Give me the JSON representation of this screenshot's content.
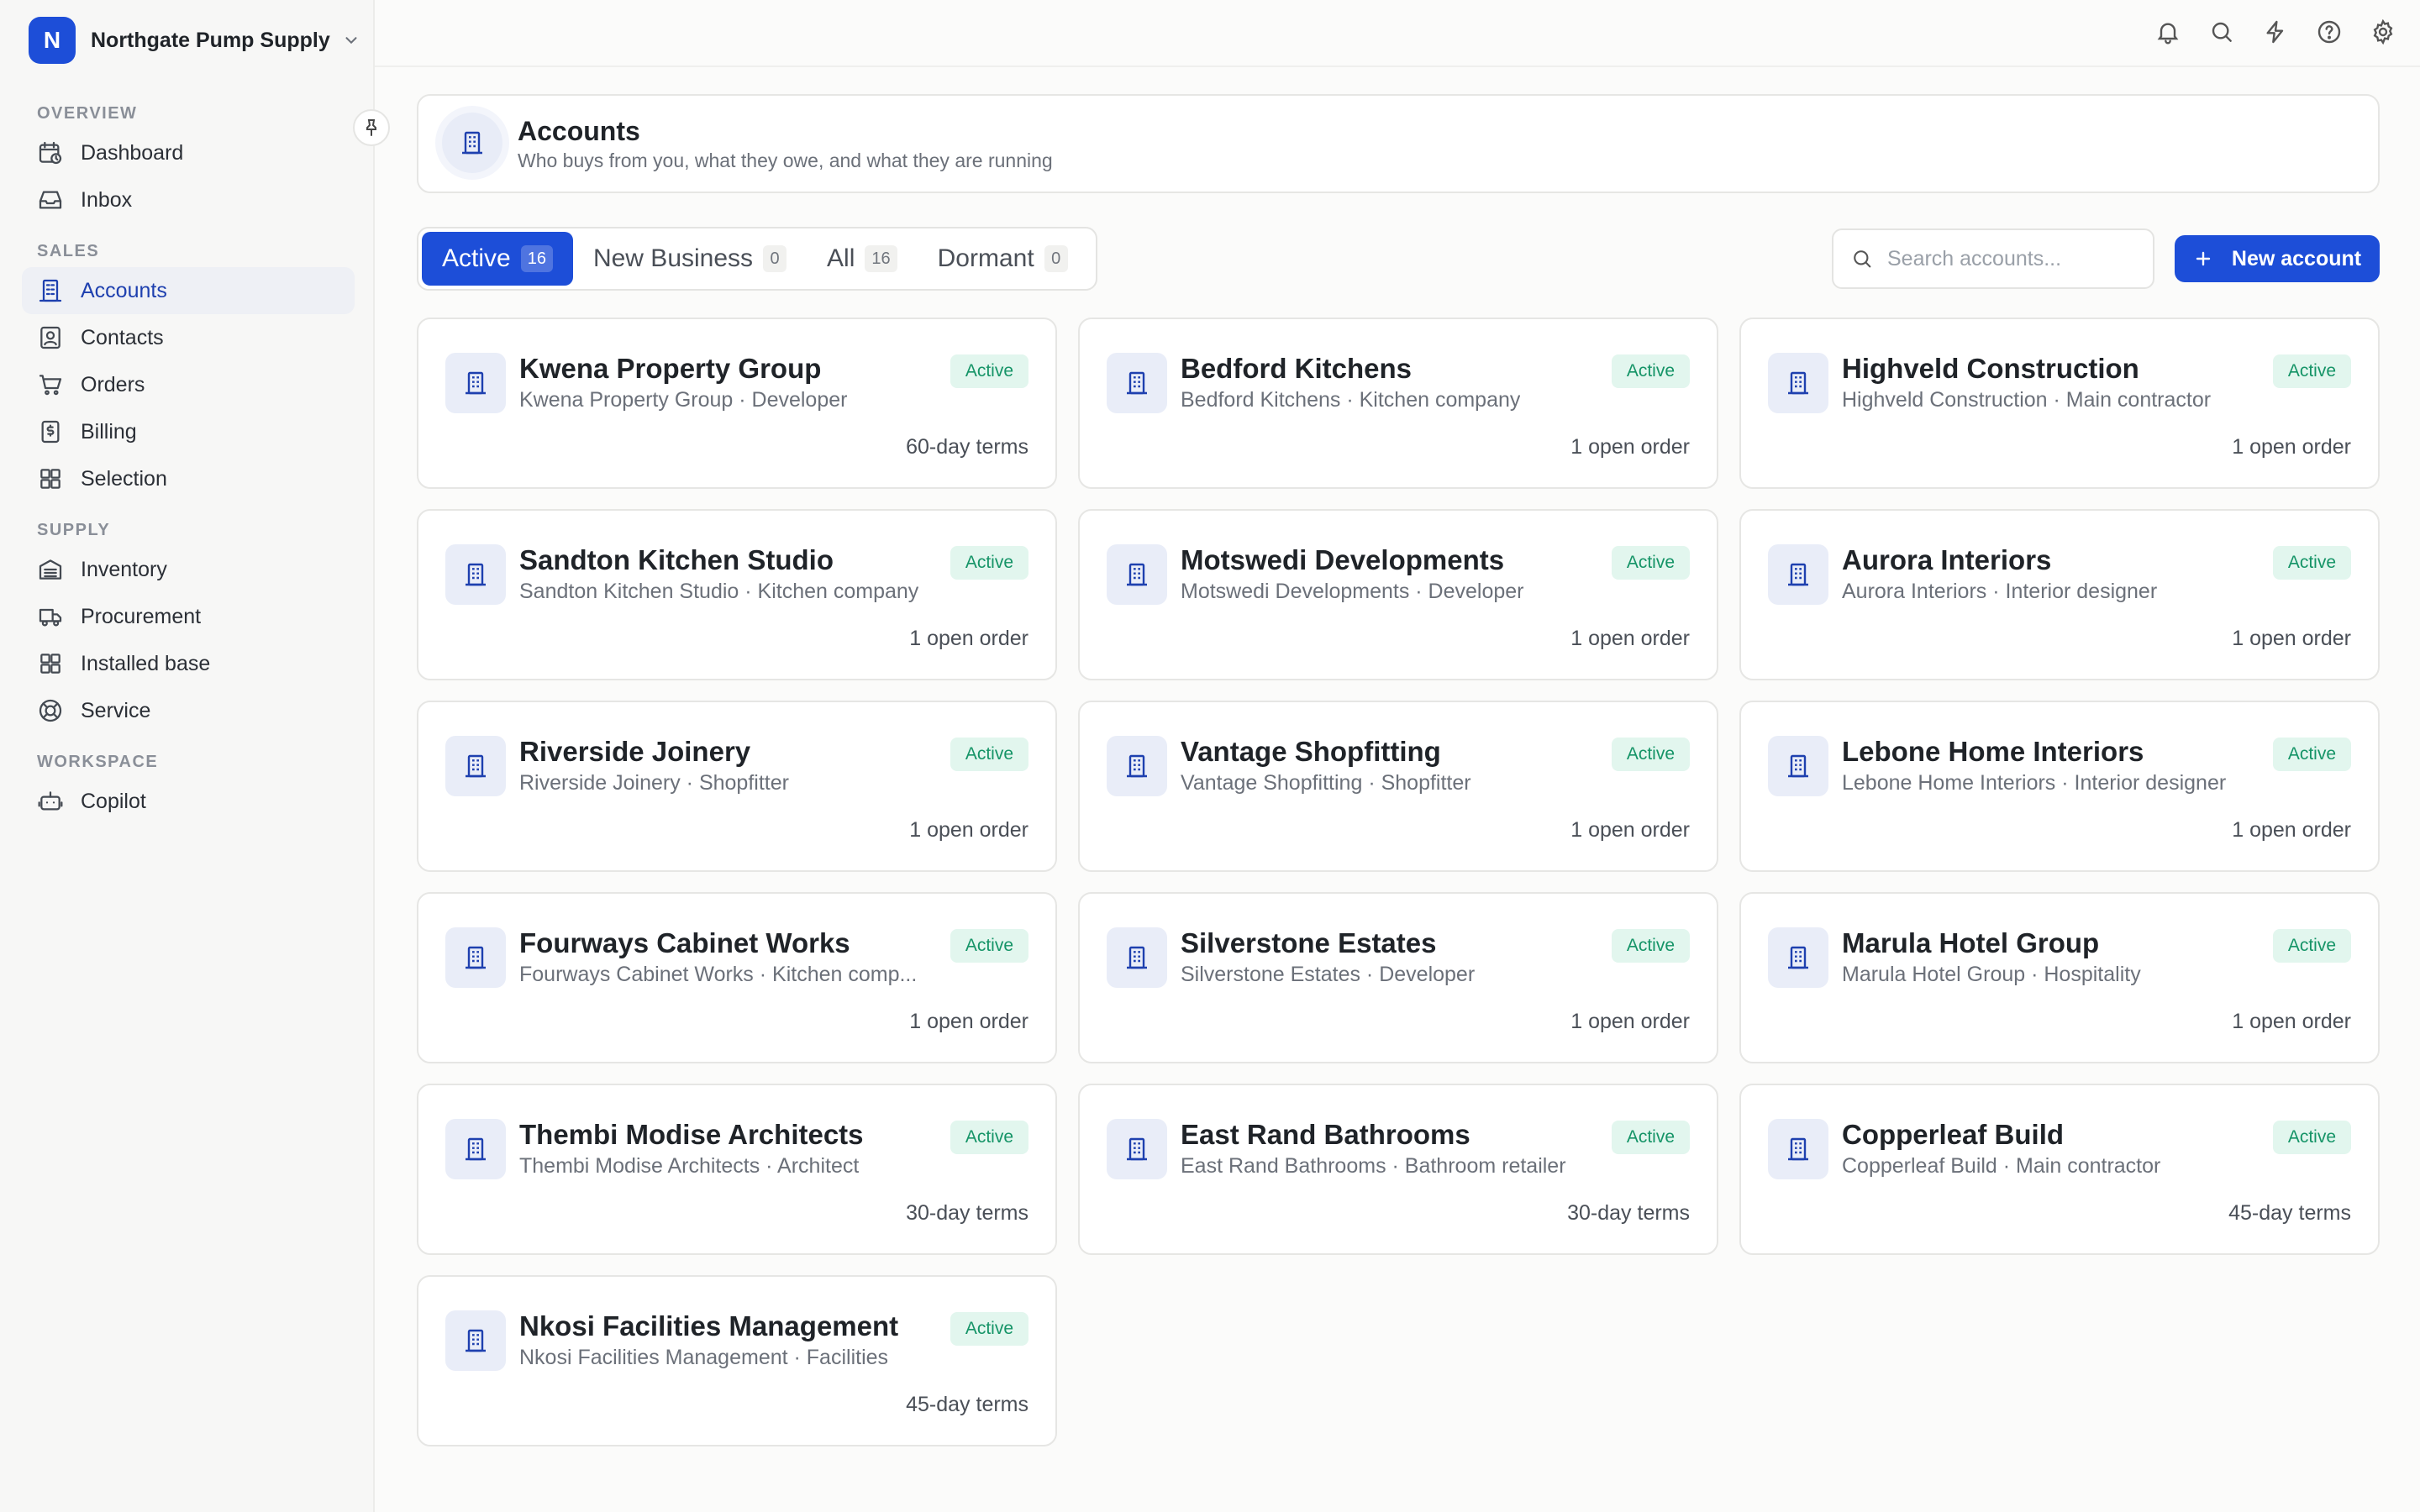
{
  "org": {
    "initial": "N",
    "name": "Northgate Pump Supply"
  },
  "nav": {
    "sections": [
      {
        "label": "OVERVIEW",
        "items": [
          {
            "label": "Dashboard",
            "icon": "calendar-clock-icon",
            "active": false
          },
          {
            "label": "Inbox",
            "icon": "inbox-icon",
            "active": false
          }
        ]
      },
      {
        "label": "SALES",
        "items": [
          {
            "label": "Accounts",
            "icon": "building-icon",
            "active": true
          },
          {
            "label": "Contacts",
            "icon": "contact-card-icon",
            "active": false
          },
          {
            "label": "Orders",
            "icon": "cart-icon",
            "active": false
          },
          {
            "label": "Billing",
            "icon": "dollar-receipt-icon",
            "active": false
          },
          {
            "label": "Selection",
            "icon": "grid-icon",
            "active": false
          }
        ]
      },
      {
        "label": "SUPPLY",
        "items": [
          {
            "label": "Inventory",
            "icon": "warehouse-icon",
            "active": false
          },
          {
            "label": "Procurement",
            "icon": "truck-icon",
            "active": false
          },
          {
            "label": "Installed base",
            "icon": "grid-icon",
            "active": false
          },
          {
            "label": "Service",
            "icon": "lifebuoy-icon",
            "active": false
          }
        ]
      },
      {
        "label": "WORKSPACE",
        "items": [
          {
            "label": "Copilot",
            "icon": "bot-icon",
            "active": false
          }
        ]
      }
    ]
  },
  "topbar": {
    "icons": [
      "bell-icon",
      "search-icon",
      "lightning-icon",
      "help-icon",
      "settings-icon"
    ]
  },
  "header": {
    "title": "Accounts",
    "subtitle": "Who buys from you, what they owe, and what they are running"
  },
  "tabs": [
    {
      "label": "Active",
      "count": "16",
      "active": true
    },
    {
      "label": "New Business",
      "count": "0",
      "active": false
    },
    {
      "label": "All",
      "count": "16",
      "active": false
    },
    {
      "label": "Dormant",
      "count": "0",
      "active": false
    }
  ],
  "search": {
    "placeholder": "Search accounts..."
  },
  "new_account_label": "New account",
  "accounts": [
    {
      "name": "Kwena Property Group",
      "meta": "Kwena Property Group · Developer",
      "status": "Active",
      "footer": "60-day terms"
    },
    {
      "name": "Bedford Kitchens",
      "meta": "Bedford Kitchens · Kitchen company",
      "status": "Active",
      "footer": "1 open order"
    },
    {
      "name": "Highveld Construction",
      "meta": "Highveld Construction · Main contractor",
      "status": "Active",
      "footer": "1 open order"
    },
    {
      "name": "Sandton Kitchen Studio",
      "meta": "Sandton Kitchen Studio · Kitchen company",
      "status": "Active",
      "footer": "1 open order"
    },
    {
      "name": "Motswedi Developments",
      "meta": "Motswedi Developments · Developer",
      "status": "Active",
      "footer": "1 open order"
    },
    {
      "name": "Aurora Interiors",
      "meta": "Aurora Interiors · Interior designer",
      "status": "Active",
      "footer": "1 open order"
    },
    {
      "name": "Riverside Joinery",
      "meta": "Riverside Joinery · Shopfitter",
      "status": "Active",
      "footer": "1 open order"
    },
    {
      "name": "Vantage Shopfitting",
      "meta": "Vantage Shopfitting · Shopfitter",
      "status": "Active",
      "footer": "1 open order"
    },
    {
      "name": "Lebone Home Interiors",
      "meta": "Lebone Home Interiors · Interior designer",
      "status": "Active",
      "footer": "1 open order"
    },
    {
      "name": "Fourways Cabinet Works",
      "meta": "Fourways Cabinet Works · Kitchen comp...",
      "status": "Active",
      "footer": "1 open order"
    },
    {
      "name": "Silverstone Estates",
      "meta": "Silverstone Estates · Developer",
      "status": "Active",
      "footer": "1 open order"
    },
    {
      "name": "Marula Hotel Group",
      "meta": "Marula Hotel Group · Hospitality",
      "status": "Active",
      "footer": "1 open order"
    },
    {
      "name": "Thembi Modise Architects",
      "meta": "Thembi Modise Architects · Architect",
      "status": "Active",
      "footer": "30-day terms"
    },
    {
      "name": "East Rand Bathrooms",
      "meta": "East Rand Bathrooms · Bathroom retailer",
      "status": "Active",
      "footer": "30-day terms"
    },
    {
      "name": "Copperleaf Build",
      "meta": "Copperleaf Build · Main contractor",
      "status": "Active",
      "footer": "45-day terms"
    },
    {
      "name": "Nkosi Facilities Management",
      "meta": "Nkosi Facilities Management · Facilities",
      "status": "Active",
      "footer": "45-day terms"
    }
  ],
  "colors": {
    "accent": "#1d4ed8",
    "active_badge_bg": "#e2f6ee",
    "active_badge_text": "#159467"
  }
}
